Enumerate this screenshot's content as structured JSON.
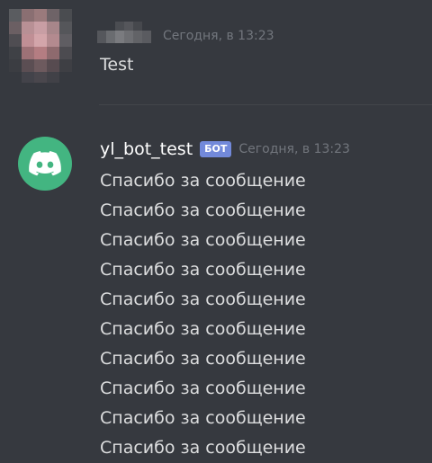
{
  "messages": [
    {
      "timestamp": "Сегодня, в 13:23",
      "text": "Test"
    },
    {
      "author": "yl_bot_test",
      "tag": "БОТ",
      "timestamp": "Сегодня, в 13:23",
      "lines": [
        "Спасибо за сообщение",
        "Спасибо за сообщение",
        "Спасибо за сообщение",
        "Спасибо за сообщение",
        "Спасибо за сообщение",
        "Спасибо за сообщение",
        "Спасибо за сообщение",
        "Спасибо за сообщение",
        "Спасибо за сообщение",
        "Спасибо за сообщение"
      ]
    }
  ],
  "colors": {
    "background": "#36393f",
    "bot_avatar": "#43b581",
    "bot_tag": "#7289da",
    "timestamp": "#72767d",
    "message_text": "#dcddde"
  },
  "icons": {
    "bot_avatar": "discord-logo-icon"
  }
}
